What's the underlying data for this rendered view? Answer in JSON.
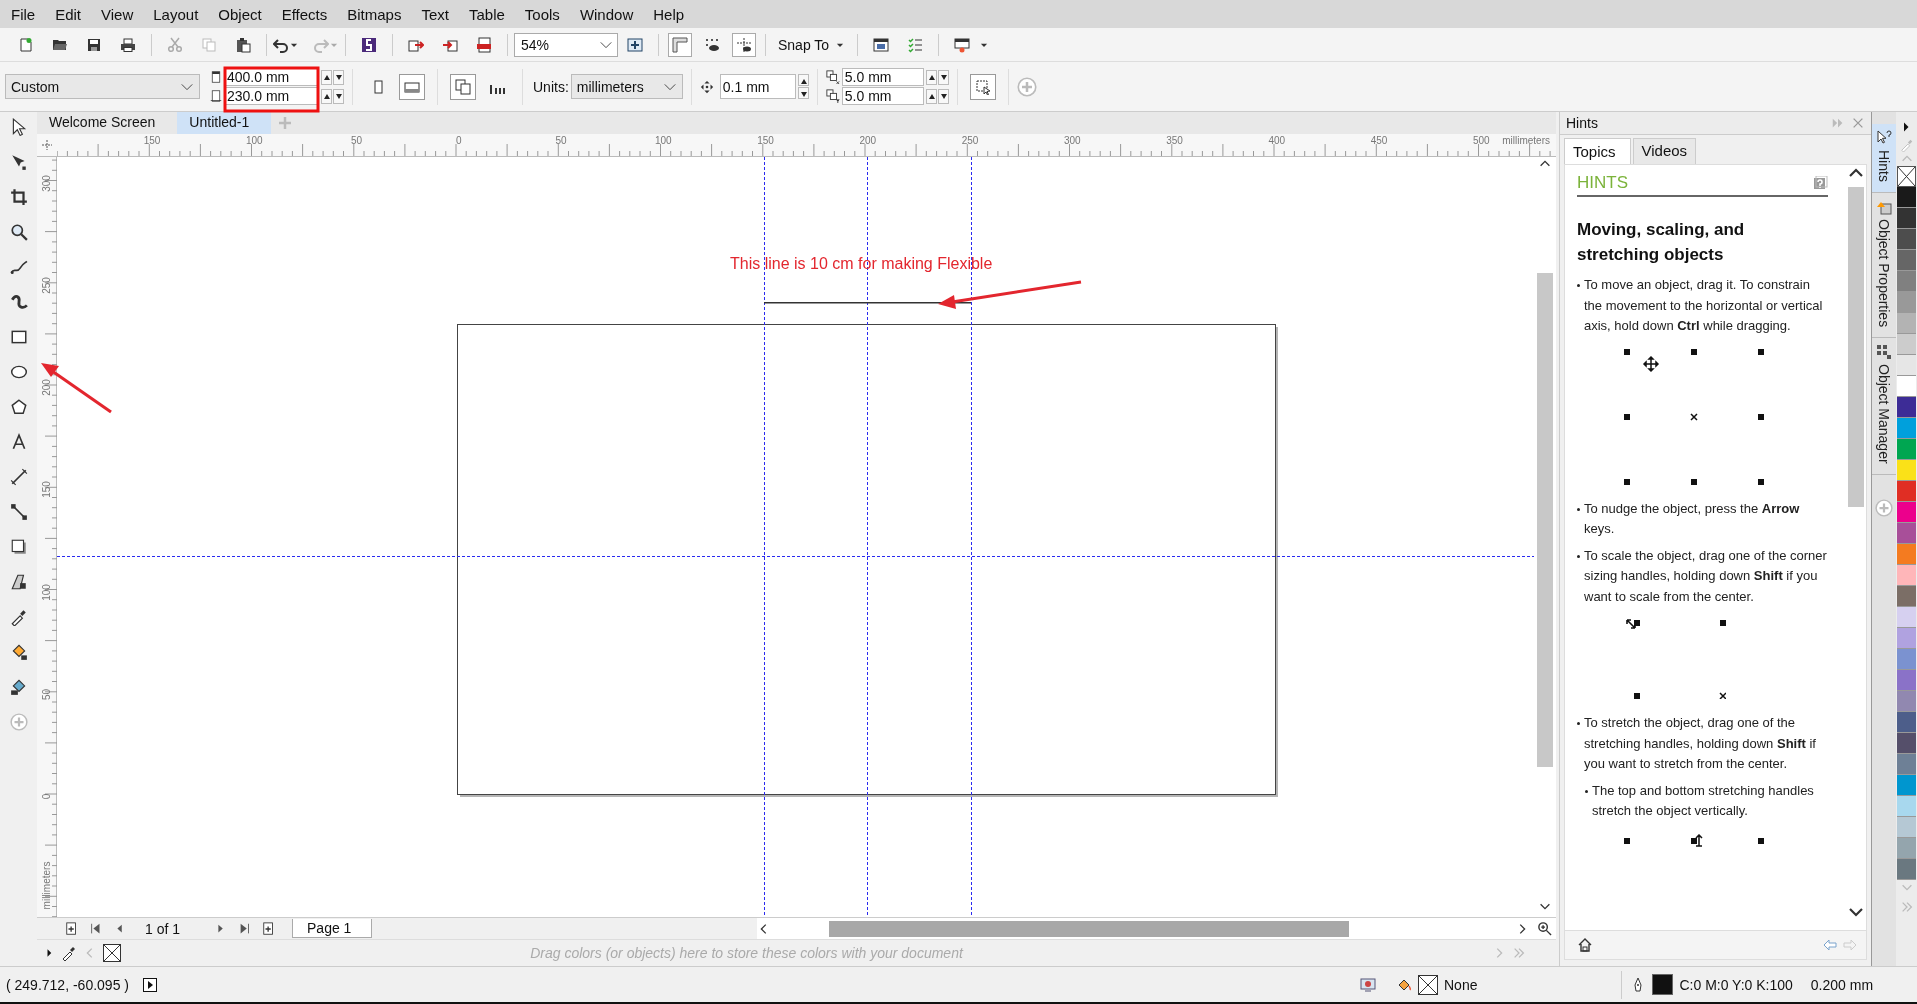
{
  "menu": [
    "File",
    "Edit",
    "View",
    "Layout",
    "Object",
    "Effects",
    "Bitmaps",
    "Text",
    "Table",
    "Tools",
    "Window",
    "Help"
  ],
  "toolbar": {
    "zoom": "54%",
    "snap": "Snap To"
  },
  "property_bar": {
    "preset": "Custom",
    "width": "400.0 mm",
    "height": "230.0 mm",
    "orientation": [
      {
        "kind": "portrait",
        "selected": false
      },
      {
        "kind": "landscape",
        "selected": true
      }
    ],
    "units_label": "Units:",
    "units": "millimeters",
    "nudge": "0.1 mm",
    "duplicate_x": "5.0 mm",
    "duplicate_y": "5.0 mm"
  },
  "document_tabs": [
    {
      "label": "Welcome Screen",
      "selected": false
    },
    {
      "label": "Untitled-1",
      "selected": true
    }
  ],
  "rulers": {
    "horizontal": [
      "150",
      "100",
      "50",
      "0",
      "50",
      "100",
      "150",
      "200",
      "250",
      "300",
      "350",
      "400",
      "450",
      "500"
    ],
    "horizontal_unit": "millimeters",
    "vertical": [
      "300",
      "250",
      "200",
      "150",
      "100",
      "50",
      "0"
    ],
    "vertical_unit": "millimeters"
  },
  "canvas": {
    "annotation": "This line is 10 cm for making Flexible"
  },
  "page_nav": {
    "count": "1 of 1",
    "tabs": [
      {
        "label": "Page 1",
        "selected": true
      }
    ]
  },
  "color_strip": {
    "hint": "Drag colors (or objects) here to store these colors with your document"
  },
  "hints_panel": {
    "title": "Hints",
    "tabs": [
      {
        "label": "Topics",
        "selected": true
      },
      {
        "label": "Videos",
        "selected": false
      }
    ],
    "heading": "HINTS",
    "topic": "Moving, scaling, and stretching objects",
    "blocks": [
      {
        "kind": "bullet",
        "text": "To move an object, drag it. To constrain the movement to the horizontal or vertical axis, hold down **Ctrl** while dragging."
      },
      {
        "kind": "move-diagram"
      },
      {
        "kind": "bullet",
        "text": "To nudge the object, press the **Arrow** keys."
      },
      {
        "kind": "bullet",
        "text": "To scale the object, drag one of the corner sizing handles, holding down **Shift** if you want to scale from the center."
      },
      {
        "kind": "scale-diagram"
      },
      {
        "kind": "bullet",
        "text": "To stretch the object, drag one of the stretching handles, holding down **Shift** if you want to stretch from the center."
      },
      {
        "kind": "sub-bullet",
        "text": "The top and bottom stretching handles stretch the object vertically."
      },
      {
        "kind": "stretch-diagram"
      }
    ]
  },
  "docker_tabs": [
    {
      "label": "Hints",
      "selected": true
    },
    {
      "label": "Object Properties",
      "selected": false
    },
    {
      "label": "Object Manager",
      "selected": false
    }
  ],
  "palette": [
    {
      "color": "#1a1a1a"
    },
    {
      "color": "#333333"
    },
    {
      "color": "#4d4d4d"
    },
    {
      "color": "#666666"
    },
    {
      "color": "#808080"
    },
    {
      "color": "#999999"
    },
    {
      "color": "#b3b3b3"
    },
    {
      "color": "#cccccc"
    },
    {
      "color": "#e6e6e6"
    },
    {
      "color": "#ffffff"
    },
    {
      "color": "#3d2c96"
    },
    {
      "color": "#00a0dc"
    },
    {
      "color": "#00a651"
    },
    {
      "color": "#fae118"
    },
    {
      "color": "#e02e24"
    },
    {
      "color": "#ec008c"
    },
    {
      "color": "#a84f99"
    },
    {
      "color": "#f47b20"
    },
    {
      "color": "#ffb6b9"
    },
    {
      "color": "#7b6e66"
    },
    {
      "color": "#d6d0f0"
    },
    {
      "color": "#b0a2e0"
    },
    {
      "color": "#7b92d0"
    },
    {
      "color": "#8a72c8"
    },
    {
      "color": "#9188b0"
    },
    {
      "color": "#4d5e8a"
    },
    {
      "color": "#554f6a"
    },
    {
      "color": "#6e8096"
    },
    {
      "color": "#0096cf"
    },
    {
      "color": "#a8d8ee"
    },
    {
      "color": "#b5c8d4"
    },
    {
      "color": "#94a5ad"
    },
    {
      "color": "#6a7880"
    }
  ],
  "status_bar": {
    "coordinates": "( 249.712, -60.095 )",
    "fill": "None",
    "outline_color": "C:0 M:0 Y:0 K:100",
    "outline_width": "0.200 mm"
  }
}
